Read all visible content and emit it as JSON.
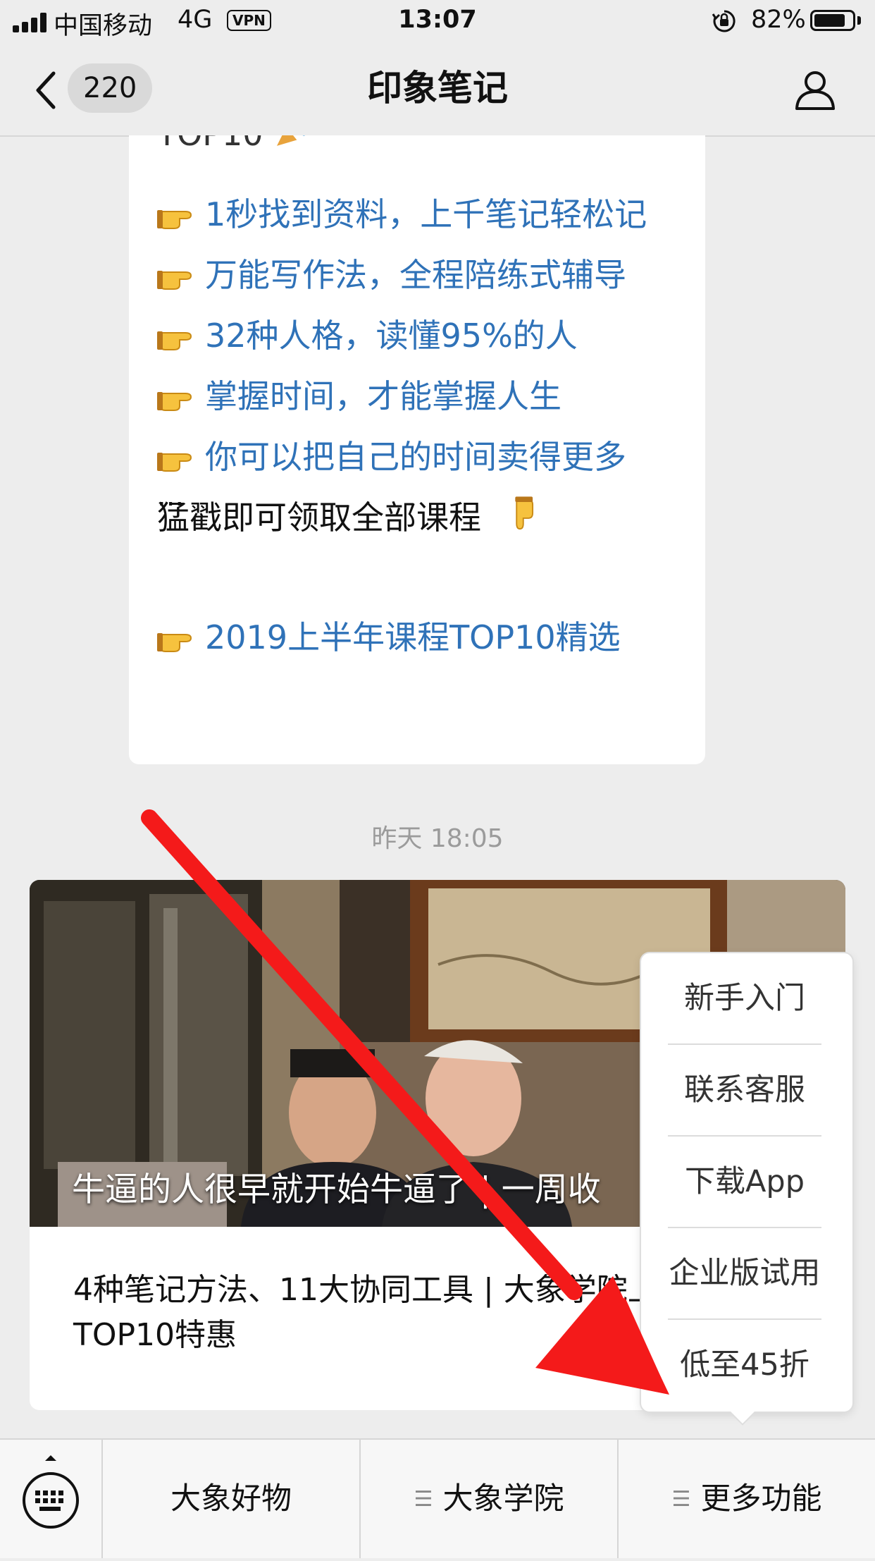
{
  "status_bar": {
    "carrier": "中国移动",
    "network": "4G",
    "vpn": "VPN",
    "time": "13:07",
    "battery_percent": "82%",
    "battery_level": 0.82
  },
  "nav": {
    "unread_count": "220",
    "title": "印象笔记"
  },
  "message": {
    "top_fragment": "TOP10",
    "lines": [
      "1秒找到资料，上千笔记轻松记",
      "万能写作法，全程陪练式辅导",
      "32种人格，读懂95%的人",
      "掌握时间，才能掌握人生",
      "你可以把自己的时间卖得更多"
    ],
    "ellipsis": "...",
    "cta": "猛戳即可领取全部课程",
    "last_link": "2019上半年课程TOP10精选"
  },
  "timestamp": "昨天 18:05",
  "article": {
    "cover_title": "牛逼的人很早就开始牛逼了 | 一周收",
    "description": "4种笔记方法、11大协同工具 | 大象学院上半年课程TOP10特惠"
  },
  "popup_menu": {
    "items": [
      "新手入门",
      "联系客服",
      "下载App",
      "企业版试用",
      "低至45折"
    ]
  },
  "bottom_menu": {
    "tabs": [
      "大象好物",
      "大象学院",
      "更多功能"
    ]
  }
}
